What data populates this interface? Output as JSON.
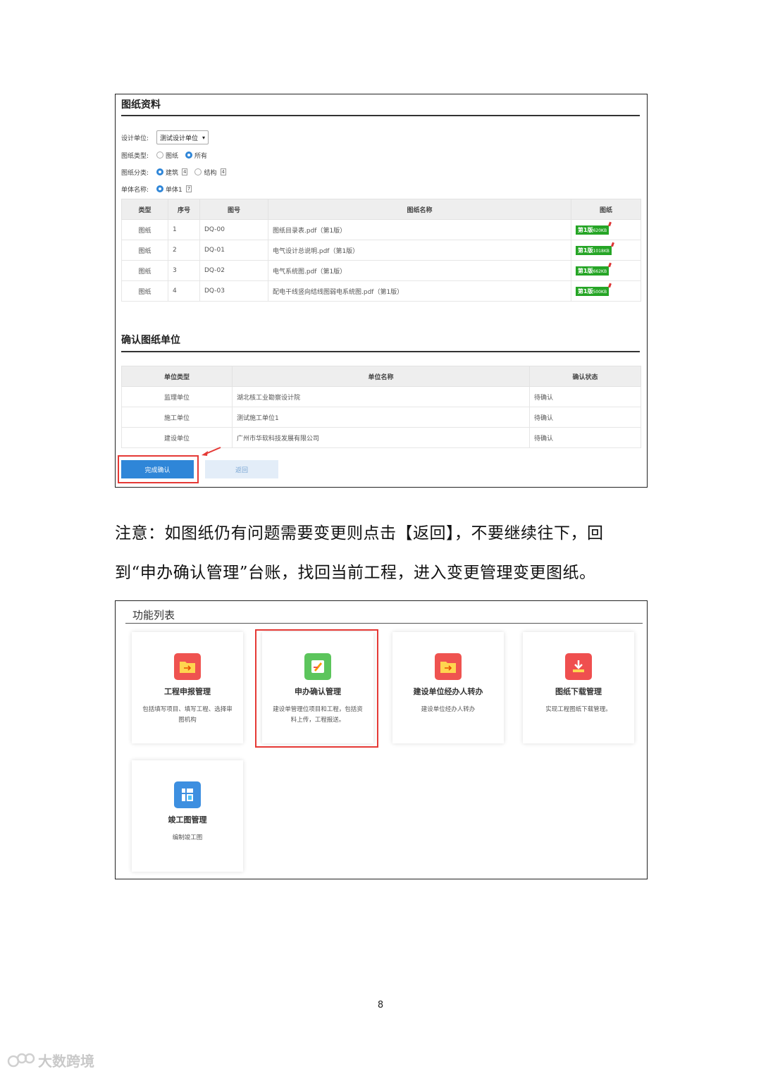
{
  "shot1": {
    "drawings_title": "图纸资料",
    "design_unit_label": "设计单位:",
    "design_unit_value": "测试设计单位",
    "drawing_type_label": "图纸类型:",
    "drawing_type_opt1": "图纸",
    "drawing_type_opt2": "所有",
    "category_label": "图纸分类:",
    "category_opt1": "建筑",
    "category_opt1_count": "4",
    "category_opt2": "结构",
    "category_opt2_count": "4",
    "unit_name_label": "单体名称:",
    "unit_name_opt1": "单体1",
    "unit_name_opt1_count": "7",
    "drawings_headers": [
      "类型",
      "序号",
      "图号",
      "图纸名称",
      "图纸"
    ],
    "drawings_rows": [
      {
        "type": "图纸",
        "no": "1",
        "code": "DQ-00",
        "name": "图纸目录表.pdf（第1版）",
        "ver": "第1版",
        "size": "620KB"
      },
      {
        "type": "图纸",
        "no": "2",
        "code": "DQ-01",
        "name": "电气设计总说明.pdf（第1版）",
        "ver": "第1版",
        "size": "1018KB"
      },
      {
        "type": "图纸",
        "no": "3",
        "code": "DQ-02",
        "name": "电气系统图.pdf（第1版）",
        "ver": "第1版",
        "size": "662KB"
      },
      {
        "type": "图纸",
        "no": "4",
        "code": "DQ-03",
        "name": "配电干线竖向结线图弱电系统图.pdf（第1版）",
        "ver": "第1版",
        "size": "500KB"
      }
    ],
    "confirm_title": "确认图纸单位",
    "confirm_headers": [
      "单位类型",
      "单位名称",
      "确认状态"
    ],
    "confirm_rows": [
      {
        "unit_type": "监理单位",
        "unit_name": "湖北核工业勘察设计院",
        "status": "待确认"
      },
      {
        "unit_type": "施工单位",
        "unit_name": "测试施工单位1",
        "status": "待确认"
      },
      {
        "unit_type": "建设单位",
        "unit_name": "广州市华软科技发展有限公司",
        "status": "待确认"
      }
    ],
    "btn_confirm": "完成确认",
    "btn_back": "返回"
  },
  "note": {
    "line1": "注意：如图纸仍有问题需要变更则点击【返回】，不要继续往下，回",
    "line2": "到“申办确认管理”台账，找回当前工程，进入变更管理变更图纸。"
  },
  "shot2": {
    "title": "功能列表",
    "cards": [
      {
        "title": "工程申报管理",
        "desc": "包括填写项目、填写工程、选择审图机构",
        "icon": "folder-arrow-icon",
        "color": "#ef5350"
      },
      {
        "title": "申办确认管理",
        "desc": "建设单管理位项目和工程，包括资料上传，工程报送。",
        "icon": "edit-pencil-icon",
        "color": "#5cc55c"
      },
      {
        "title": "建设单位经办人转办",
        "desc": "建设单位经办人转办",
        "icon": "folder-arrow-icon",
        "color": "#ef5350"
      },
      {
        "title": "图纸下载管理",
        "desc": "实现工程图纸下载管理。",
        "icon": "download-icon",
        "color": "#ef4f4f"
      },
      {
        "title": "竣工图管理",
        "desc": "编制竣工图",
        "icon": "blueprint-icon",
        "color": "#3d8fe0"
      }
    ]
  },
  "page_number": "8",
  "watermark": "大数跨境"
}
